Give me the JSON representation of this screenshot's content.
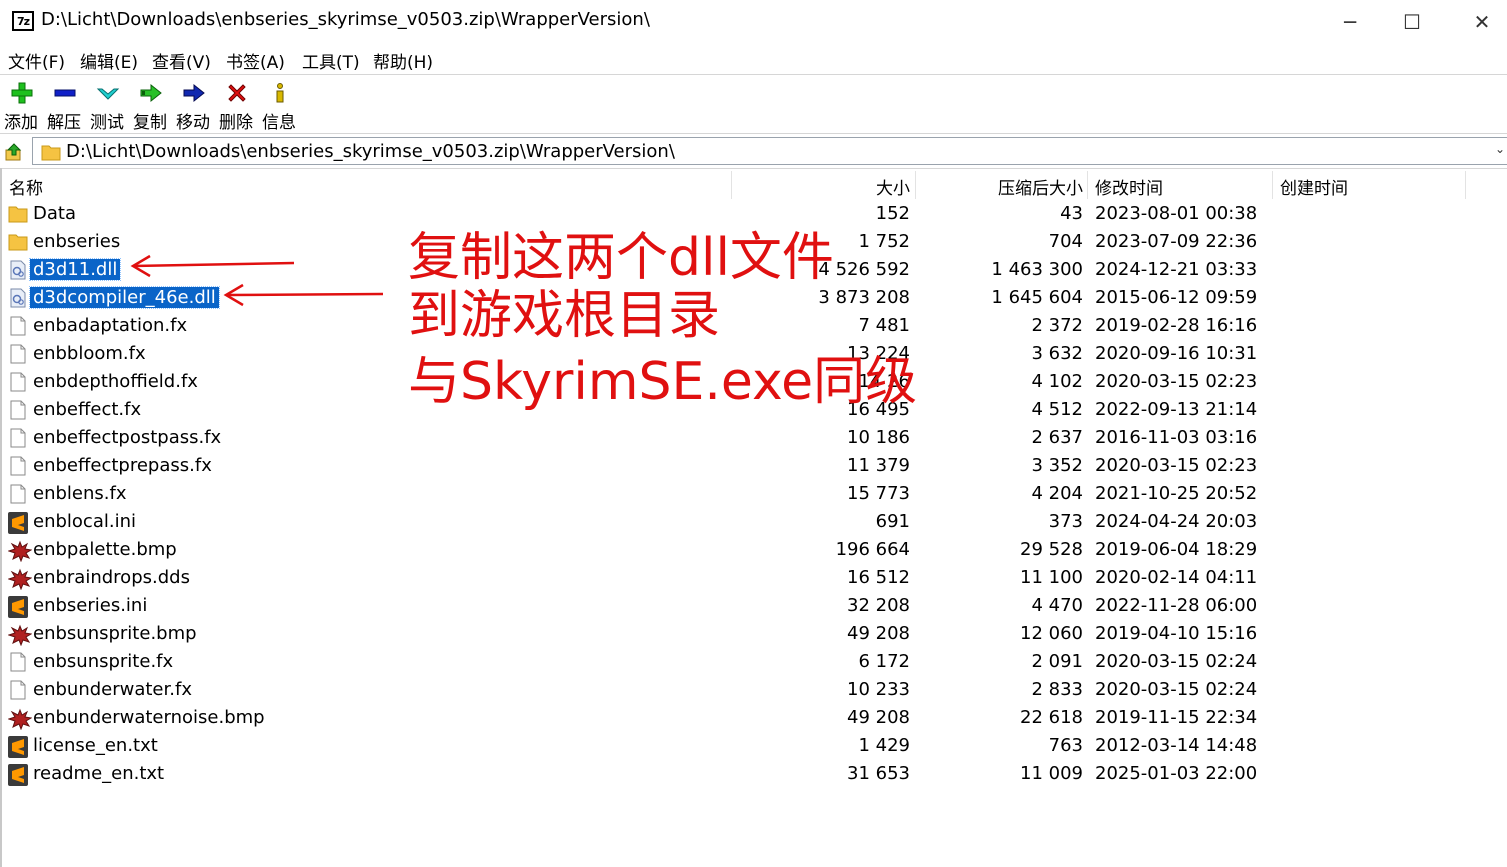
{
  "window": {
    "app_icon_text": "7z",
    "title": "D:\\Licht\\Downloads\\enbseries_skyrimse_v0503.zip\\WrapperVersion\\",
    "minimize": "─",
    "maximize": "☐",
    "close": "✕"
  },
  "menu": [
    "文件(F)",
    "编辑(E)",
    "查看(V)",
    "书签(A)",
    "工具(T)",
    "帮助(H)"
  ],
  "toolbar": {
    "add": "添加",
    "extract": "解压",
    "test": "测试",
    "copy": "复制",
    "move": "移动",
    "delete": "删除",
    "info": "信息"
  },
  "address": {
    "path": "D:\\Licht\\Downloads\\enbseries_skyrimse_v0503.zip\\WrapperVersion\\",
    "dropdown": "⌄"
  },
  "columns": {
    "name": "名称",
    "size": "大小",
    "packed": "压缩后大小",
    "modified": "修改时间",
    "created": "创建时间"
  },
  "files": [
    {
      "name": "Data",
      "size": "152",
      "packed": "43",
      "modified": "2023-08-01 00:38",
      "icon": "folder"
    },
    {
      "name": "enbseries",
      "size": "1 752",
      "packed": "704",
      "modified": "2023-07-09 22:36",
      "icon": "folder"
    },
    {
      "name": "d3d11.dll",
      "size": "4 526 592",
      "packed": "1 463 300",
      "modified": "2024-12-21 03:33",
      "icon": "dll",
      "selected": true
    },
    {
      "name": "d3dcompiler_46e.dll",
      "size": "3 873 208",
      "packed": "1 645 604",
      "modified": "2015-06-12 09:59",
      "icon": "dll",
      "selected": true
    },
    {
      "name": "enbadaptation.fx",
      "size": "7 481",
      "packed": "2 372",
      "modified": "2019-02-28 16:16",
      "icon": "file"
    },
    {
      "name": "enbbloom.fx",
      "size": "13 224",
      "packed": "3 632",
      "modified": "2020-09-16 10:31",
      "icon": "file"
    },
    {
      "name": "enbdepthoffield.fx",
      "size": "14 26",
      "packed": "4 102",
      "modified": "2020-03-15 02:23",
      "icon": "file"
    },
    {
      "name": "enbeffect.fx",
      "size": "16 495",
      "packed": "4 512",
      "modified": "2022-09-13 21:14",
      "icon": "file"
    },
    {
      "name": "enbeffectpostpass.fx",
      "size": "10 186",
      "packed": "2 637",
      "modified": "2016-11-03 03:16",
      "icon": "file"
    },
    {
      "name": "enbeffectprepass.fx",
      "size": "11 379",
      "packed": "3 352",
      "modified": "2020-03-15 02:23",
      "icon": "file"
    },
    {
      "name": "enblens.fx",
      "size": "15 773",
      "packed": "4 204",
      "modified": "2021-10-25 20:52",
      "icon": "file"
    },
    {
      "name": "enblocal.ini",
      "size": "691",
      "packed": "373",
      "modified": "2024-04-24 20:03",
      "icon": "sublime"
    },
    {
      "name": "enbpalette.bmp",
      "size": "196 664",
      "packed": "29 528",
      "modified": "2019-06-04 18:29",
      "icon": "image"
    },
    {
      "name": "enbraindrops.dds",
      "size": "16 512",
      "packed": "11 100",
      "modified": "2020-02-14 04:11",
      "icon": "image"
    },
    {
      "name": "enbseries.ini",
      "size": "32 208",
      "packed": "4 470",
      "modified": "2022-11-28 06:00",
      "icon": "sublime"
    },
    {
      "name": "enbsunsprite.bmp",
      "size": "49 208",
      "packed": "12 060",
      "modified": "2019-04-10 15:16",
      "icon": "image"
    },
    {
      "name": "enbsunsprite.fx",
      "size": "6 172",
      "packed": "2 091",
      "modified": "2020-03-15 02:24",
      "icon": "file"
    },
    {
      "name": "enbunderwater.fx",
      "size": "10 233",
      "packed": "2 833",
      "modified": "2020-03-15 02:24",
      "icon": "file"
    },
    {
      "name": "enbunderwaternoise.bmp",
      "size": "49 208",
      "packed": "22 618",
      "modified": "2019-11-15 22:34",
      "icon": "image"
    },
    {
      "name": "license_en.txt",
      "size": "1 429",
      "packed": "763",
      "modified": "2012-03-14 14:48",
      "icon": "sublime"
    },
    {
      "name": "readme_en.txt",
      "size": "31 653",
      "packed": "11 009",
      "modified": "2025-01-03 22:00",
      "icon": "sublime"
    }
  ],
  "annotation": {
    "line1": "复制这两个dll文件",
    "line2": "到游戏根目录",
    "line3": "与SkyrimSE.exe同级",
    "color": "#e01010"
  }
}
